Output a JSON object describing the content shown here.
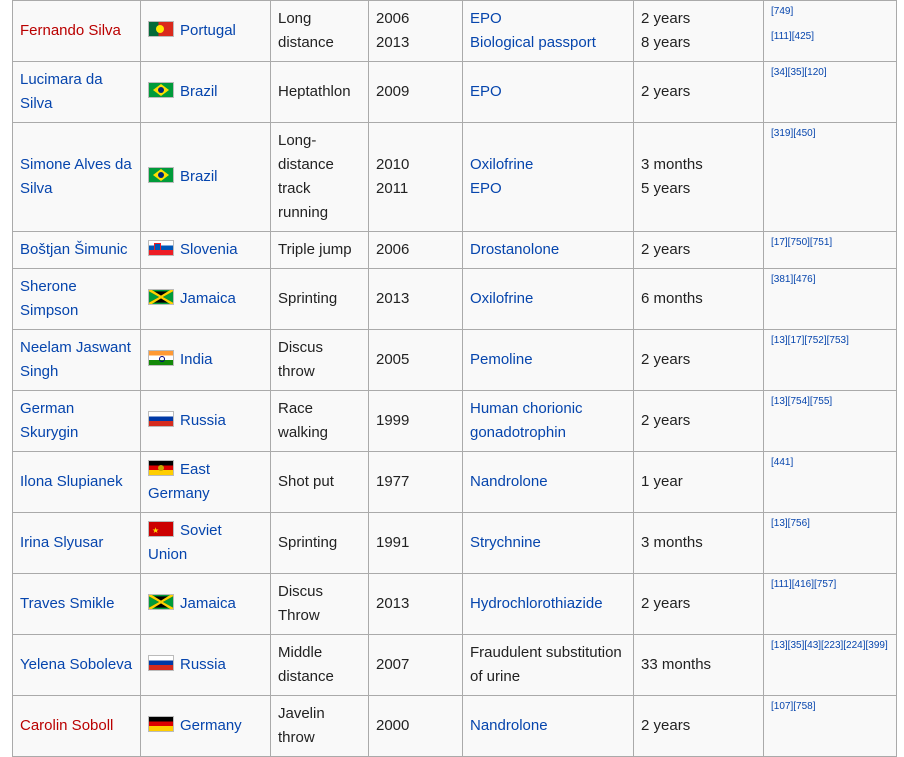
{
  "rows": [
    {
      "name": "Fernando Silva",
      "name_red": true,
      "flag": "pt",
      "country": "Portugal",
      "event": "Long distance",
      "years": [
        "2006",
        "2013"
      ],
      "substance": [
        "EPO",
        "Biological passport"
      ],
      "sub_link": true,
      "ban": [
        "2 years",
        "8 years"
      ],
      "refs": [
        "[749]",
        "[111][425]"
      ]
    },
    {
      "name": "Lucimara da Silva",
      "flag": "br",
      "country": "Brazil",
      "event": "Heptathlon",
      "years": [
        "2009"
      ],
      "substance": [
        "EPO"
      ],
      "sub_link": true,
      "ban": [
        "2 years"
      ],
      "refs": [
        "[34][35][120]"
      ]
    },
    {
      "name": "Simone Alves da Silva",
      "flag": "br",
      "country": "Brazil",
      "event": "Long-distance track running",
      "years": [
        "2010",
        "2011"
      ],
      "substance": [
        "Oxilofrine",
        "EPO"
      ],
      "sub_link": true,
      "ban": [
        "3 months",
        "5 years"
      ],
      "refs": [
        "[319][450]"
      ]
    },
    {
      "name": "Boštjan Šimunic",
      "flag": "si",
      "country": "Slovenia",
      "event": "Triple jump",
      "years": [
        "2006"
      ],
      "substance": [
        "Drostanolone"
      ],
      "sub_link": true,
      "ban": [
        "2 years"
      ],
      "refs": [
        "[17][750][751]"
      ]
    },
    {
      "name": "Sherone Simpson",
      "flag": "jm",
      "country": "Jamaica",
      "event": "Sprinting",
      "years": [
        "2013"
      ],
      "substance": [
        "Oxilofrine"
      ],
      "sub_link": true,
      "ban": [
        "6 months"
      ],
      "refs": [
        "[381][476]"
      ]
    },
    {
      "name": "Neelam Jaswant Singh",
      "flag": "in",
      "country": "India",
      "event": "Discus throw",
      "years": [
        "2005"
      ],
      "substance": [
        "Pemoline"
      ],
      "sub_link": true,
      "ban": [
        "2 years"
      ],
      "refs": [
        "[13][17][752][753]"
      ]
    },
    {
      "name": "German Skurygin",
      "flag": "ru",
      "country": "Russia",
      "event": "Race walking",
      "years": [
        "1999"
      ],
      "substance": [
        "Human chorionic gonadotrophin"
      ],
      "sub_link": true,
      "ban": [
        "2 years"
      ],
      "refs": [
        "[13][754][755]"
      ]
    },
    {
      "name": "Ilona Slupianek",
      "flag": "gd",
      "country": "East Germany",
      "event": "Shot put",
      "years": [
        "1977"
      ],
      "substance": [
        "Nandrolone"
      ],
      "sub_link": true,
      "ban": [
        "1 year"
      ],
      "refs": [
        "[441]"
      ]
    },
    {
      "name": "Irina Slyusar",
      "flag": "su",
      "country": "Soviet Union",
      "event": "Sprinting",
      "years": [
        "1991"
      ],
      "substance": [
        "Strychnine"
      ],
      "sub_link": true,
      "ban": [
        "3 months"
      ],
      "refs": [
        "[13][756]"
      ]
    },
    {
      "name": "Traves Smikle",
      "flag": "jm",
      "country": "Jamaica",
      "event": "Discus Throw",
      "years": [
        "2013"
      ],
      "substance": [
        "Hydrochlorothiazide"
      ],
      "sub_link": true,
      "ban": [
        "2 years"
      ],
      "refs": [
        "[111][416][757]"
      ]
    },
    {
      "name": "Yelena Soboleva",
      "flag": "ru",
      "country": "Russia",
      "event": "Middle distance",
      "years": [
        "2007"
      ],
      "substance": [
        "Fraudulent substitution of urine"
      ],
      "sub_link": false,
      "ban": [
        "33 months"
      ],
      "refs": [
        "[13][35][43][223][224][399]"
      ]
    },
    {
      "name": "Carolin Soboll",
      "name_red": true,
      "flag": "de",
      "country": "Germany",
      "event": "Javelin throw",
      "years": [
        "2000"
      ],
      "substance": [
        "Nandrolone"
      ],
      "sub_link": true,
      "ban": [
        "2 years"
      ],
      "refs": [
        "[107][758]"
      ]
    }
  ]
}
